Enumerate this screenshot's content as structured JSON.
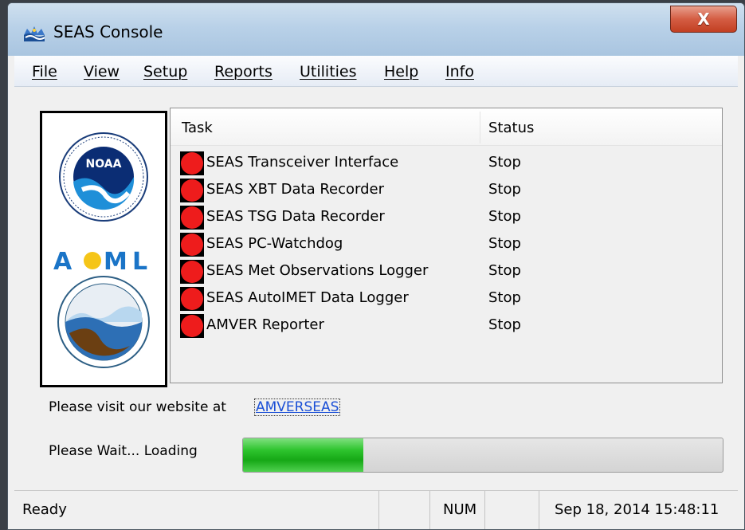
{
  "window": {
    "title": "SEAS Console",
    "close_glyph": "X"
  },
  "menu": [
    {
      "label": "File"
    },
    {
      "label": "View"
    },
    {
      "label": "Setup"
    },
    {
      "label": "Reports"
    },
    {
      "label": "Utilities"
    },
    {
      "label": "Help"
    },
    {
      "label": "Info"
    }
  ],
  "logos": {
    "noara_text": "NOAA",
    "aoml_text": "AOML"
  },
  "tasks": {
    "columns": {
      "task": "Task",
      "status": "Status"
    },
    "rows": [
      {
        "name": "SEAS Transceiver Interface",
        "status": "Stop"
      },
      {
        "name": "SEAS XBT Data Recorder",
        "status": "Stop"
      },
      {
        "name": "SEAS TSG Data Recorder",
        "status": "Stop"
      },
      {
        "name": "SEAS PC-Watchdog",
        "status": "Stop"
      },
      {
        "name": "SEAS Met Observations Logger",
        "status": "Stop"
      },
      {
        "name": "SEAS AutoIMET Data Logger",
        "status": "Stop"
      },
      {
        "name": "AMVER Reporter",
        "status": "Stop"
      }
    ],
    "status_color": "#ee1c1c"
  },
  "website": {
    "prefix": "Please visit our website at",
    "link_text": "AMVERSEAS"
  },
  "loading": {
    "label": "Please Wait... Loading",
    "progress_fraction": 0.25
  },
  "statusbar": {
    "ready": "Ready",
    "num": "NUM",
    "datetime": "Sep 18, 2014 15:48:11"
  }
}
